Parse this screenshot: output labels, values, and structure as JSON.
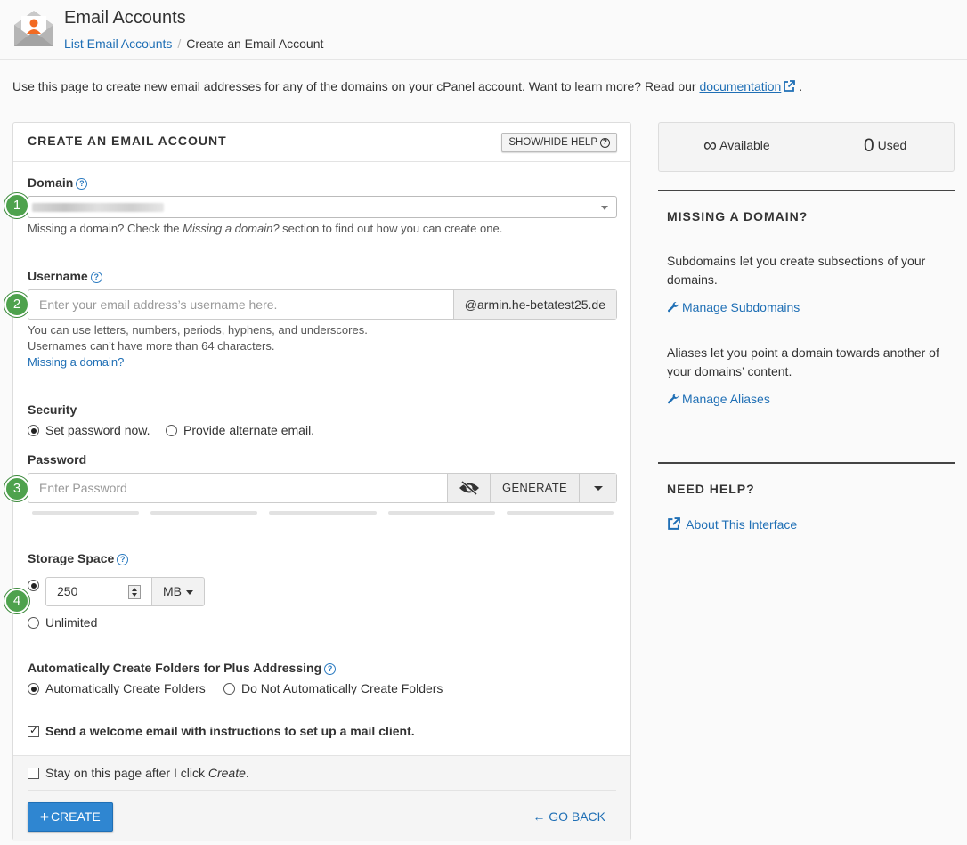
{
  "header": {
    "title": "Email Accounts",
    "breadcrumb": {
      "parent": "List Email Accounts",
      "separator": "/",
      "current": "Create an Email Account"
    }
  },
  "intro": {
    "text": "Use this page to create new email addresses for any of the domains on your cPanel account. Want to learn more? Read our",
    "link": "documentation",
    "suffix": "."
  },
  "form": {
    "title": "CREATE AN EMAIL ACCOUNT",
    "show_hide_help": "SHOW/HIDE HELP",
    "steps": [
      "1",
      "2",
      "3",
      "4"
    ],
    "domain": {
      "label": "Domain",
      "hint_before": "Missing a domain? Check the ",
      "hint_em": "Missing a domain?",
      "hint_after": " section to find out how you can create one."
    },
    "username": {
      "label": "Username",
      "placeholder": "Enter your email address’s username here.",
      "suffix": "@armin.he-betatest25.de",
      "hint1": "You can use letters, numbers, periods, hyphens, and underscores.",
      "hint2": "Usernames can’t have more than 64 characters.",
      "missing_link": "Missing a domain?"
    },
    "security": {
      "label": "Security",
      "options": [
        {
          "label": "Set password now.",
          "selected": true
        },
        {
          "label": "Provide alternate email.",
          "selected": false
        }
      ]
    },
    "password": {
      "label": "Password",
      "placeholder": "Enter Password",
      "generate": "GENERATE"
    },
    "storage": {
      "label": "Storage Space",
      "value": "250",
      "unit": "MB",
      "unlimited": "Unlimited",
      "selected": "value"
    },
    "plus_addressing": {
      "label": "Automatically Create Folders for Plus Addressing",
      "options": [
        {
          "label": "Automatically Create Folders",
          "selected": true
        },
        {
          "label": "Do Not Automatically Create Folders",
          "selected": false
        }
      ]
    },
    "welcome": {
      "label": "Send a welcome email with instructions to set up a mail client.",
      "checked": true
    },
    "stay": {
      "label_before": "Stay on this page after I click ",
      "label_em": "Create",
      "label_after": ".",
      "checked": false
    },
    "create_button": "CREATE",
    "go_back": "GO BACK"
  },
  "sidebar": {
    "available_symbol": "∞",
    "available_label": "Available",
    "used_count": "0",
    "used_label": "Used",
    "missing_domain": {
      "heading": "MISSING A DOMAIN?",
      "subdomains_text": "Subdomains let you create subsections of your domains.",
      "subdomains_link": "Manage Subdomains",
      "aliases_text": "Aliases let you point a domain towards another of your domains’ content.",
      "aliases_link": "Manage Aliases"
    },
    "need_help": {
      "heading": "NEED HELP?",
      "link": "About This Interface"
    }
  },
  "colors": {
    "accent": "#2f86d1",
    "link": "#1f6fb5",
    "step_badge": "#4ea24d",
    "icon_orange": "#f26a22"
  }
}
